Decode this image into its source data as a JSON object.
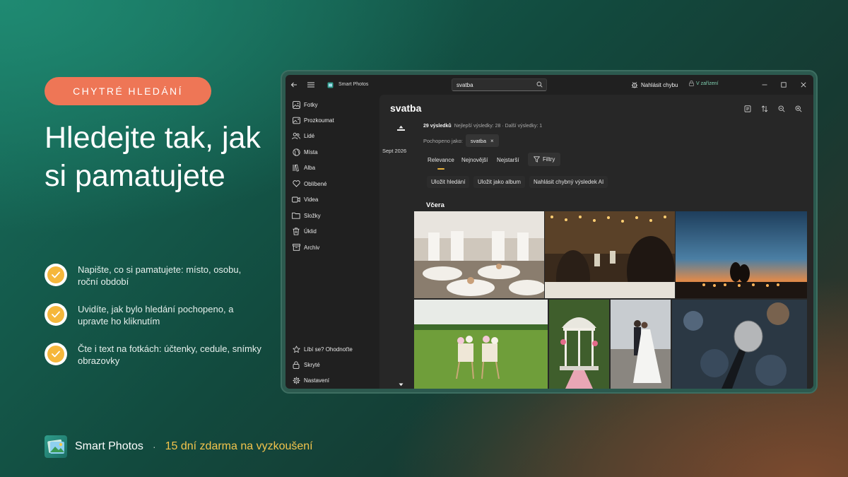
{
  "promo": {
    "badge": "CHYTRÉ HLEDÁNÍ",
    "headline": "Hledejte tak, jak si pamatujete",
    "features": [
      "Napište, co si pamatujete: místo, osobu, roční období",
      "Uvidíte, jak bylo hledání pochopeno, a upravte ho kliknutím",
      "Čte i text na fotkách: účtenky, cedule, snímky obrazovky"
    ],
    "footer_app_name": "Smart Photos",
    "footer_separator": "·",
    "footer_offer": "15 dní zdarma na vyzkoušení"
  },
  "titlebar": {
    "app_title": "Smart Photos",
    "search_value": "svatba",
    "report_label": "Nahlásit chybu",
    "device_label": "V zařízení"
  },
  "sidebar": {
    "items": [
      {
        "label": "Fotky",
        "icon": "image-icon"
      },
      {
        "label": "Prozkoumat",
        "icon": "explore-icon"
      },
      {
        "label": "Lidé",
        "icon": "people-icon"
      },
      {
        "label": "Místa",
        "icon": "globe-icon"
      },
      {
        "label": "Alba",
        "icon": "albums-icon"
      },
      {
        "label": "Oblíbené",
        "icon": "heart-icon"
      },
      {
        "label": "Videa",
        "icon": "video-icon"
      },
      {
        "label": "Složky",
        "icon": "folder-icon"
      },
      {
        "label": "Úklid",
        "icon": "trash-icon"
      },
      {
        "label": "Archiv",
        "icon": "archive-icon"
      }
    ],
    "bottom_items": [
      {
        "label": "Líbí se? Ohodnoťte",
        "icon": "star-icon"
      },
      {
        "label": "Skryté",
        "icon": "lock-icon"
      },
      {
        "label": "Nastavení",
        "icon": "gear-icon"
      }
    ]
  },
  "content": {
    "title": "svatba",
    "results_count": "29 výsledků",
    "results_detail": "Nejlepší výsledky: 28 · Další výsledky: 1",
    "understood_label": "Pochopeno jako:",
    "understood_chip": "svatba",
    "sort_tabs": [
      "Relevance",
      "Nejnovější",
      "Nejstarší"
    ],
    "filter_label": "Filtry",
    "actions": [
      "Uložit hledání",
      "Uložit jako album",
      "Nahlásit chybný výsledek AI"
    ],
    "section_label": "Včera",
    "timeline_date": "Sept 2026"
  },
  "colors": {
    "accent_badge": "#ee7656",
    "check": "#f5b73b",
    "offer": "#f3c44c",
    "sort_underline": "#e9b23c",
    "device_label": "#7fcfb0"
  }
}
